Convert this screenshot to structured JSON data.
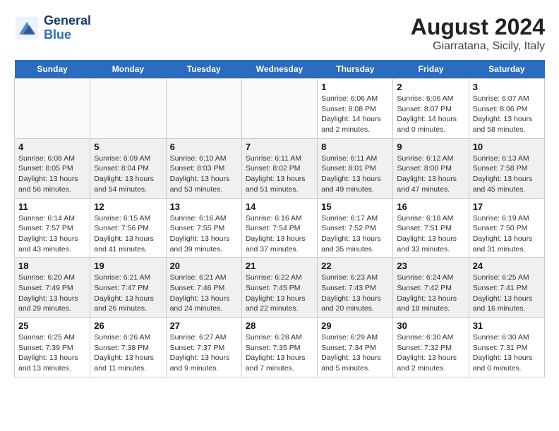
{
  "header": {
    "logo_line1": "General",
    "logo_line2": "Blue",
    "title": "August 2024",
    "subtitle": "Giarratana, Sicily, Italy"
  },
  "days_of_week": [
    "Sunday",
    "Monday",
    "Tuesday",
    "Wednesday",
    "Thursday",
    "Friday",
    "Saturday"
  ],
  "weeks": [
    [
      {
        "day": "",
        "info": ""
      },
      {
        "day": "",
        "info": ""
      },
      {
        "day": "",
        "info": ""
      },
      {
        "day": "",
        "info": ""
      },
      {
        "day": "1",
        "info": "Sunrise: 6:06 AM\nSunset: 8:08 PM\nDaylight: 14 hours\nand 2 minutes."
      },
      {
        "day": "2",
        "info": "Sunrise: 6:06 AM\nSunset: 8:07 PM\nDaylight: 14 hours\nand 0 minutes."
      },
      {
        "day": "3",
        "info": "Sunrise: 6:07 AM\nSunset: 8:06 PM\nDaylight: 13 hours\nand 58 minutes."
      }
    ],
    [
      {
        "day": "4",
        "info": "Sunrise: 6:08 AM\nSunset: 8:05 PM\nDaylight: 13 hours\nand 56 minutes."
      },
      {
        "day": "5",
        "info": "Sunrise: 6:09 AM\nSunset: 8:04 PM\nDaylight: 13 hours\nand 54 minutes."
      },
      {
        "day": "6",
        "info": "Sunrise: 6:10 AM\nSunset: 8:03 PM\nDaylight: 13 hours\nand 53 minutes."
      },
      {
        "day": "7",
        "info": "Sunrise: 6:11 AM\nSunset: 8:02 PM\nDaylight: 13 hours\nand 51 minutes."
      },
      {
        "day": "8",
        "info": "Sunrise: 6:11 AM\nSunset: 8:01 PM\nDaylight: 13 hours\nand 49 minutes."
      },
      {
        "day": "9",
        "info": "Sunrise: 6:12 AM\nSunset: 8:00 PM\nDaylight: 13 hours\nand 47 minutes."
      },
      {
        "day": "10",
        "info": "Sunrise: 6:13 AM\nSunset: 7:58 PM\nDaylight: 13 hours\nand 45 minutes."
      }
    ],
    [
      {
        "day": "11",
        "info": "Sunrise: 6:14 AM\nSunset: 7:57 PM\nDaylight: 13 hours\nand 43 minutes."
      },
      {
        "day": "12",
        "info": "Sunrise: 6:15 AM\nSunset: 7:56 PM\nDaylight: 13 hours\nand 41 minutes."
      },
      {
        "day": "13",
        "info": "Sunrise: 6:16 AM\nSunset: 7:55 PM\nDaylight: 13 hours\nand 39 minutes."
      },
      {
        "day": "14",
        "info": "Sunrise: 6:16 AM\nSunset: 7:54 PM\nDaylight: 13 hours\nand 37 minutes."
      },
      {
        "day": "15",
        "info": "Sunrise: 6:17 AM\nSunset: 7:52 PM\nDaylight: 13 hours\nand 35 minutes."
      },
      {
        "day": "16",
        "info": "Sunrise: 6:18 AM\nSunset: 7:51 PM\nDaylight: 13 hours\nand 33 minutes."
      },
      {
        "day": "17",
        "info": "Sunrise: 6:19 AM\nSunset: 7:50 PM\nDaylight: 13 hours\nand 31 minutes."
      }
    ],
    [
      {
        "day": "18",
        "info": "Sunrise: 6:20 AM\nSunset: 7:49 PM\nDaylight: 13 hours\nand 29 minutes."
      },
      {
        "day": "19",
        "info": "Sunrise: 6:21 AM\nSunset: 7:47 PM\nDaylight: 13 hours\nand 26 minutes."
      },
      {
        "day": "20",
        "info": "Sunrise: 6:21 AM\nSunset: 7:46 PM\nDaylight: 13 hours\nand 24 minutes."
      },
      {
        "day": "21",
        "info": "Sunrise: 6:22 AM\nSunset: 7:45 PM\nDaylight: 13 hours\nand 22 minutes."
      },
      {
        "day": "22",
        "info": "Sunrise: 6:23 AM\nSunset: 7:43 PM\nDaylight: 13 hours\nand 20 minutes."
      },
      {
        "day": "23",
        "info": "Sunrise: 6:24 AM\nSunset: 7:42 PM\nDaylight: 13 hours\nand 18 minutes."
      },
      {
        "day": "24",
        "info": "Sunrise: 6:25 AM\nSunset: 7:41 PM\nDaylight: 13 hours\nand 16 minutes."
      }
    ],
    [
      {
        "day": "25",
        "info": "Sunrise: 6:25 AM\nSunset: 7:39 PM\nDaylight: 13 hours\nand 13 minutes."
      },
      {
        "day": "26",
        "info": "Sunrise: 6:26 AM\nSunset: 7:38 PM\nDaylight: 13 hours\nand 11 minutes."
      },
      {
        "day": "27",
        "info": "Sunrise: 6:27 AM\nSunset: 7:37 PM\nDaylight: 13 hours\nand 9 minutes."
      },
      {
        "day": "28",
        "info": "Sunrise: 6:28 AM\nSunset: 7:35 PM\nDaylight: 13 hours\nand 7 minutes."
      },
      {
        "day": "29",
        "info": "Sunrise: 6:29 AM\nSunset: 7:34 PM\nDaylight: 13 hours\nand 5 minutes."
      },
      {
        "day": "30",
        "info": "Sunrise: 6:30 AM\nSunset: 7:32 PM\nDaylight: 13 hours\nand 2 minutes."
      },
      {
        "day": "31",
        "info": "Sunrise: 6:30 AM\nSunset: 7:31 PM\nDaylight: 13 hours\nand 0 minutes."
      }
    ]
  ]
}
